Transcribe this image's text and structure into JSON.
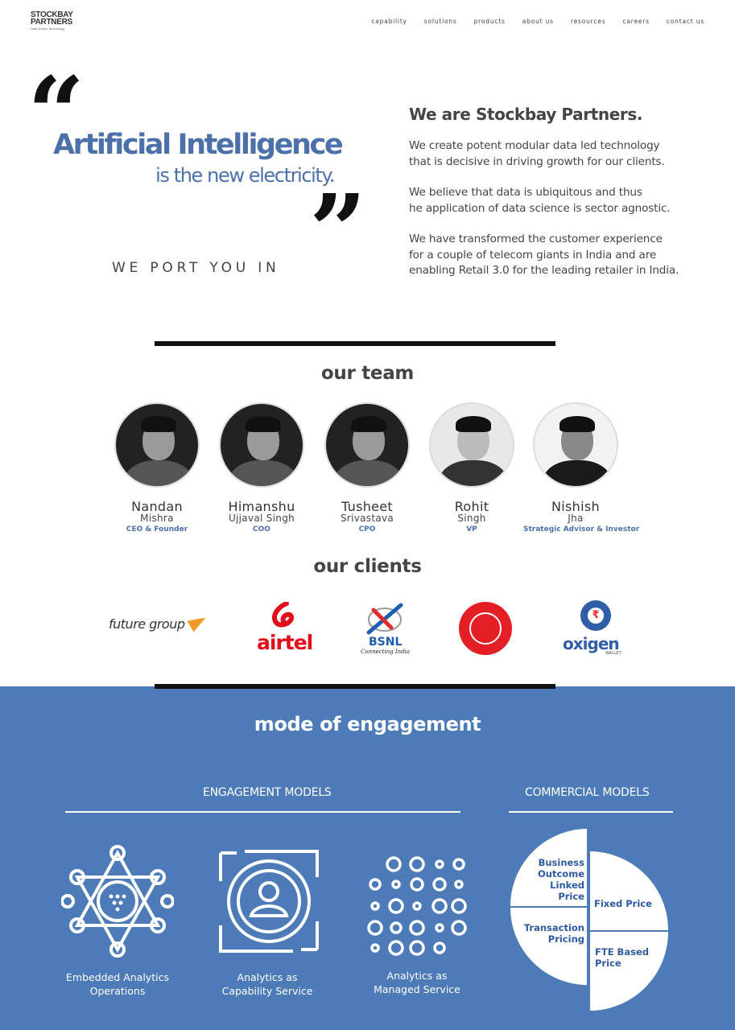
{
  "logo": {
    "line1": "STOCKBAY",
    "line2": "PARTNERS",
    "tagline": "Data Driven Technology"
  },
  "nav": [
    "capability",
    "solutions",
    "products",
    "about us",
    "resources",
    "careers",
    "contact us"
  ],
  "hero": {
    "quote_open": "“",
    "quote_close": "”",
    "headline": "Artificial Intelligence",
    "subline": "is the new electricity.",
    "port": "WE PORT YOU IN"
  },
  "about": {
    "title": "We are Stockbay Partners.",
    "p1_l1": "We create potent modular data led technology",
    "p1_l2": "that is decisive in driving growth for our clients.",
    "p2_l1": "We believe that data is ubiquitous and thus",
    "p2_l2": "he application of data science is sector agnostic.",
    "p3_l1": "We have transformed the customer experience",
    "p3_l2": "for a couple of telecom giants in India and are",
    "p3_l3": "enabling Retail 3.0 for the leading retailer in India."
  },
  "team": {
    "title": "our team",
    "members": [
      {
        "first": "Nandan",
        "last": "Mishra",
        "role": "CEO & Founder"
      },
      {
        "first": "Himanshu",
        "last": "Ujjaval Singh",
        "role": "COO"
      },
      {
        "first": "Tusheet",
        "last": "Srivastava",
        "role": "CPO"
      },
      {
        "first": "Rohit",
        "last": "Singh",
        "role": "VP"
      },
      {
        "first": "Nishish",
        "last": "Jha",
        "role": "Strategic Advisor & Investor"
      }
    ]
  },
  "clients": {
    "title": "our clients",
    "future_group": "future group",
    "airtel": "airtel",
    "bsnl": "BSNL",
    "bsnl_tag": "Connecting India",
    "oxigen": "oxigen",
    "oxigen_tag": "WALLET"
  },
  "engagement": {
    "title": "mode of engagement",
    "engagement_head": "ENGAGEMENT MODELS",
    "commercial_head": "COMMERCIAL MODELS",
    "models": [
      {
        "l1": "Embedded Analytics",
        "l2": "Operations"
      },
      {
        "l1": "Analytics as",
        "l2": "Capability Service"
      },
      {
        "l1": "Analytics as",
        "l2": "Managed Service"
      }
    ],
    "commercial": {
      "outcome_l1": "Business",
      "outcome_l2": "Outcome",
      "outcome_l3": "Linked",
      "outcome_l4": "Price",
      "fixed": "Fixed Price",
      "transaction_l1": "Transaction",
      "transaction_l2": "Pricing",
      "fte_l1": "FTE Based",
      "fte_l2": "Price"
    }
  },
  "colors": {
    "brand_blue": "#4b70aa",
    "section_blue": "#4c7bb8",
    "airtel_red": "#e20d1a",
    "rail_red": "#e31e24"
  }
}
